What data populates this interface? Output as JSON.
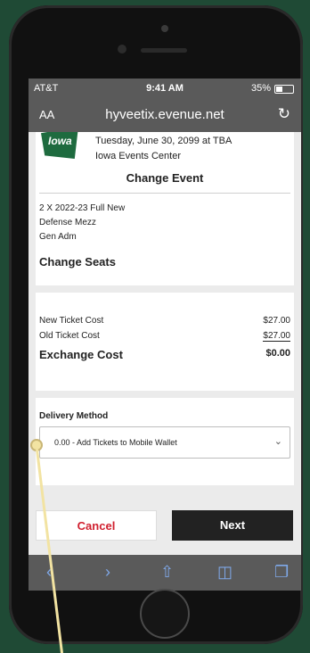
{
  "status_bar": {
    "carrier": "AT&T",
    "time": "9:41 AM",
    "battery": "35%"
  },
  "url_bar": {
    "text_size_label": "AA",
    "domain": "hyveetix.evenue.net",
    "reload_icon": "reload-icon"
  },
  "event": {
    "logo_text": "Iowa",
    "date": "Tuesday, June 30, 2099 at TBA",
    "venue": "Iowa Events Center",
    "change_event_label": "Change Event"
  },
  "seats": {
    "lines": [
      "2 X 2022-23 Full New",
      "Defense Mezz",
      "Gen Adm"
    ],
    "change_seats_label": "Change Seats"
  },
  "costs": {
    "new_ticket_cost_label": "New Ticket Cost",
    "new_ticket_cost_value": "$27.00",
    "old_ticket_cost_label": "Old Ticket Cost",
    "old_ticket_cost_value": "$27.00",
    "exchange_cost_label": "Exchange Cost",
    "exchange_cost_value": "$0.00"
  },
  "delivery": {
    "label": "Delivery Method",
    "selected": "0.00 - Add Tickets to Mobile Wallet"
  },
  "actions": {
    "cancel_label": "Cancel",
    "next_label": "Next"
  },
  "toolbar": {
    "icons": [
      "back-icon",
      "forward-icon",
      "share-icon",
      "bookmarks-icon",
      "tabs-icon"
    ]
  },
  "colors": {
    "background": "#1f4a35",
    "cancel_text": "#d0202f",
    "next_bg": "#222222",
    "toolbar_icon": "#7fa8e8"
  }
}
